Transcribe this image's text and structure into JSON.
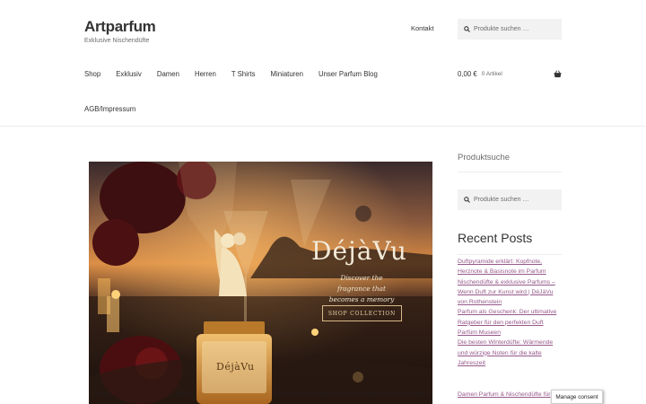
{
  "header": {
    "site_title": "Artparfum",
    "tagline": "Exklusive Nischendüfte",
    "secondary_nav": {
      "contact": "Kontakt"
    },
    "search": {
      "placeholder": "Produkte suchen …",
      "icon": "search-icon"
    },
    "nav_items": [
      "Shop",
      "Exklusiv",
      "Damen",
      "Herren",
      "T Shirts",
      "Miniaturen",
      "Unser Parfum Blog"
    ],
    "nav_row2": "AGB/Impressum",
    "cart": {
      "amount": "0,00 €",
      "count": "0 Artikel",
      "icon": "basket-icon"
    }
  },
  "hero": {
    "brand": "DéjàVu",
    "tagline": "Discover the fragrance that becomes a memory",
    "button": "SHOP COLLECTION",
    "bottle_label": "DéjàVu"
  },
  "sidebar": {
    "product_search_title": "Produktsuche",
    "search_placeholder": "Produkte suchen …",
    "recent_posts_title": "Recent Posts",
    "recent_posts": [
      "Duftpyramide erklärt: Kopfnote, Herznote & Basisnote im Parfum",
      "Nischendüfte & exklusive Parfums – Wenn Duft zur Kunst wird | DéJàVu von Rothenstein",
      "Parfum als Geschenk: Der ultimative Ratgeber für den perfekten Duft",
      "Parfüm Museen",
      "Die besten Winterdüfte: Wärmende und würzige Noten für die kalte Jahreszeit"
    ],
    "next_link": "Damen Parfum & Nischendüfte für"
  },
  "consent": {
    "label": "Manage consent"
  },
  "colors": {
    "link": "#96588a",
    "text": "#333333",
    "search_bg": "#f2f2f2"
  }
}
